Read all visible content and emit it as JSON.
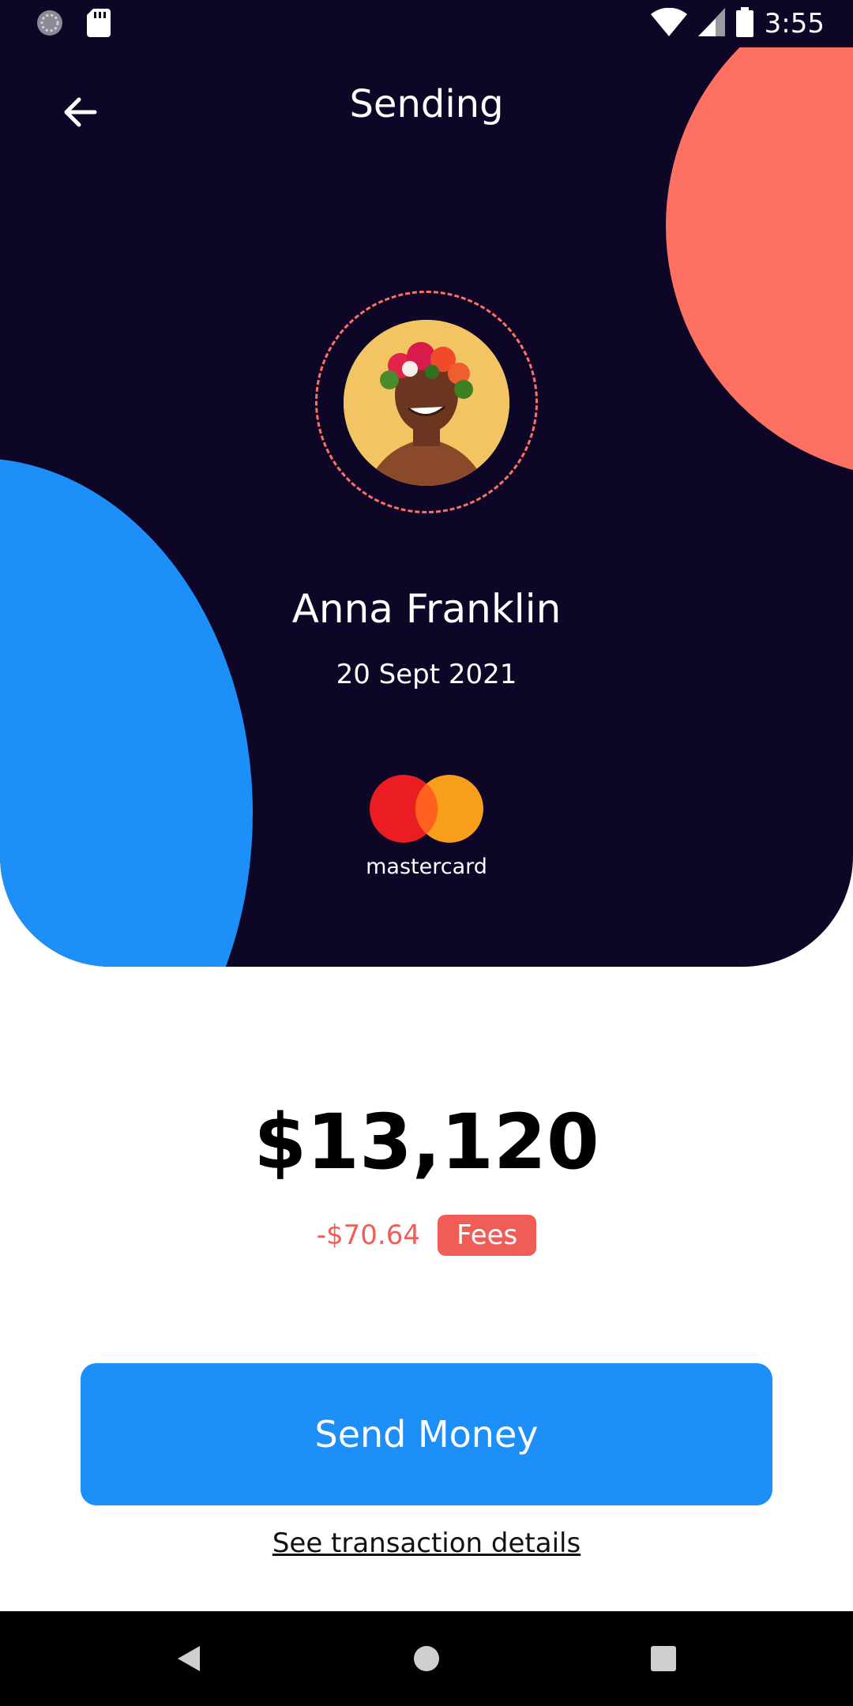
{
  "status_bar": {
    "time": "3:55"
  },
  "header": {
    "title": "Sending"
  },
  "recipient": {
    "name": "Anna Franklin",
    "date": "20 Sept 2021"
  },
  "payment": {
    "card_brand": "mastercard"
  },
  "amount": {
    "value": "$13,120",
    "fee": "-$70.64",
    "fee_label": "Fees"
  },
  "actions": {
    "send_label": "Send Money",
    "details_link": "See transaction details"
  },
  "colors": {
    "background_dark": "#0d0627",
    "accent_blue": "#1d8ff8",
    "accent_coral": "#fe7062",
    "fee_red": "#f05d56"
  },
  "icons": [
    "back-arrow-icon",
    "wifi-icon",
    "signal-icon",
    "battery-icon",
    "sd-card-icon",
    "sync-icon",
    "nav-back-icon",
    "nav-home-icon",
    "nav-recents-icon"
  ]
}
